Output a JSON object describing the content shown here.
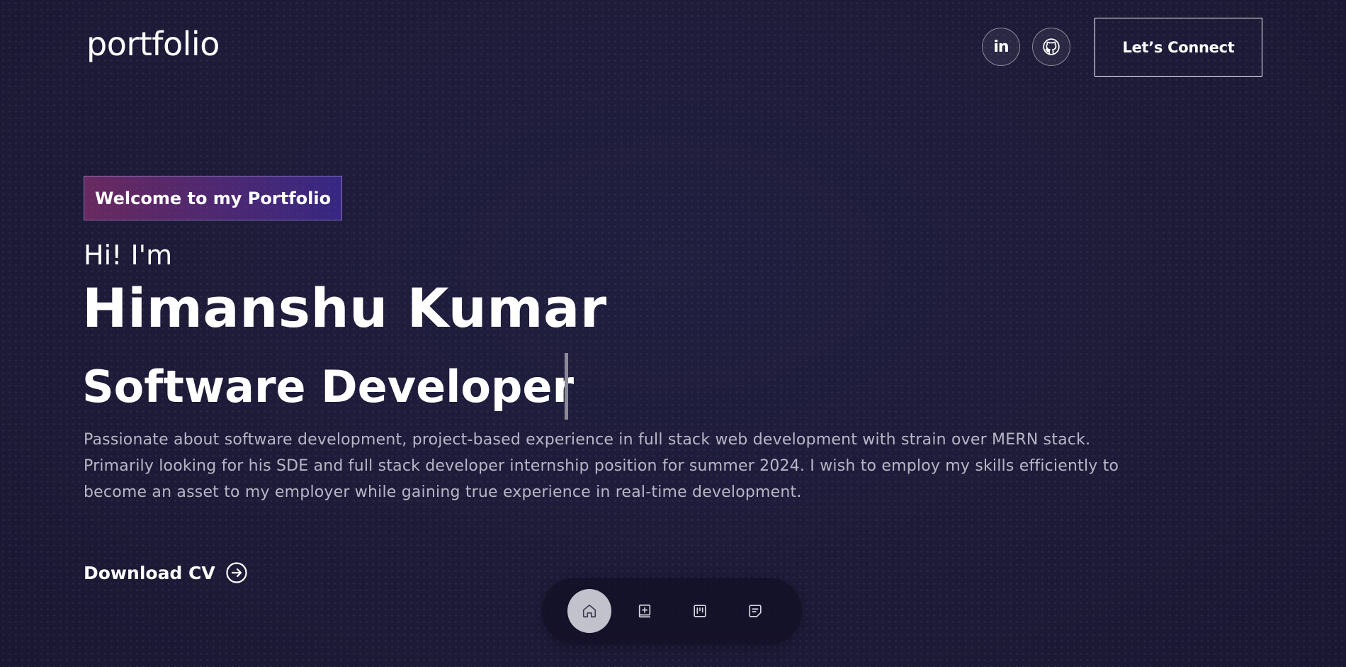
{
  "header": {
    "logo": "portfolio",
    "social": [
      {
        "name": "linkedin",
        "label": "in",
        "icon": "linkedin-icon"
      },
      {
        "name": "github",
        "icon": "github-icon"
      }
    ],
    "connect_label": "Let’s Connect"
  },
  "hero": {
    "tagline": "Welcome to my Portfolio",
    "greeting": "Hi! I'm",
    "name": "Himanshu Kumar",
    "role": "Software Developer",
    "description": [
      "Passionate about software development, project-based experience in full stack web development with strain over MERN stack.",
      "Primarily looking for his SDE and full stack developer internship position for summer 2024. I wish to employ my skills efficiently to",
      "become an asset to my employer while gaining true experience in real-time development."
    ],
    "download_label": "Download CV",
    "download_icon": "arrow-right-circle-icon"
  },
  "dock": {
    "items": [
      {
        "name": "home",
        "icon": "home-icon",
        "active": true
      },
      {
        "name": "projects",
        "icon": "book-plus-icon",
        "active": false
      },
      {
        "name": "board",
        "icon": "kanban-icon",
        "active": false
      },
      {
        "name": "notes",
        "icon": "note-icon",
        "active": false
      }
    ]
  },
  "colors": {
    "background": "#1d1b38",
    "text": "#ffffff",
    "muted_text": "#b8b6c6",
    "tagline_gradient_start": "#aa367c",
    "tagline_gradient_end": "#4a2fbd",
    "dock_active": "#c2c2cc"
  }
}
